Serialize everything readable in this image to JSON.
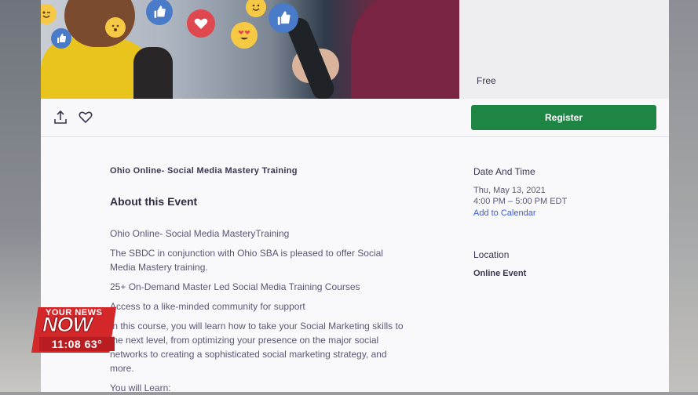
{
  "hero": {
    "emoji_icons": [
      "wink-icon",
      "thumbs-up-icon",
      "heart-icon",
      "thumbs-up-icon",
      "smile-icon",
      "thumbs-up-icon",
      "heart-eyes-icon",
      "surprised-icon"
    ]
  },
  "ticket": {
    "price": "Free",
    "register_label": "Register"
  },
  "actions": {
    "share_icon": "share-icon",
    "like_icon": "heart-outline-icon"
  },
  "event": {
    "title": "Ohio Online- Social Media Mastery Training",
    "about_heading": "About this Event",
    "paragraphs": [
      "Ohio Online- Social Media MasteryTraining",
      "The SBDC in conjunction with Ohio SBA is pleased to offer Social Media Mastery training.",
      "25+ On-Demand Master Led Social Media Training Courses",
      "Access to a like-minded community for support",
      "In this course, you will learn how to take your Social Marketing skills to the next level, from optimizing your presence on the major social networks to creating a sophisticated social marketing strategy, and more.",
      "You will Learn:"
    ]
  },
  "sidebar": {
    "date_heading": "Date And Time",
    "date": "Thu, May 13, 2021",
    "time": "4:00 PM – 5:00 PM EDT",
    "calendar_link": "Add to Calendar",
    "location_heading": "Location",
    "location": "Online Event"
  },
  "broadcast": {
    "line1": "YOUR NEWS",
    "line2": "NOW",
    "clock": "11:08 63°",
    "accent": "#d3272a"
  },
  "colors": {
    "register": "#1f8545",
    "link": "#3659e3",
    "text": "#39364f"
  }
}
